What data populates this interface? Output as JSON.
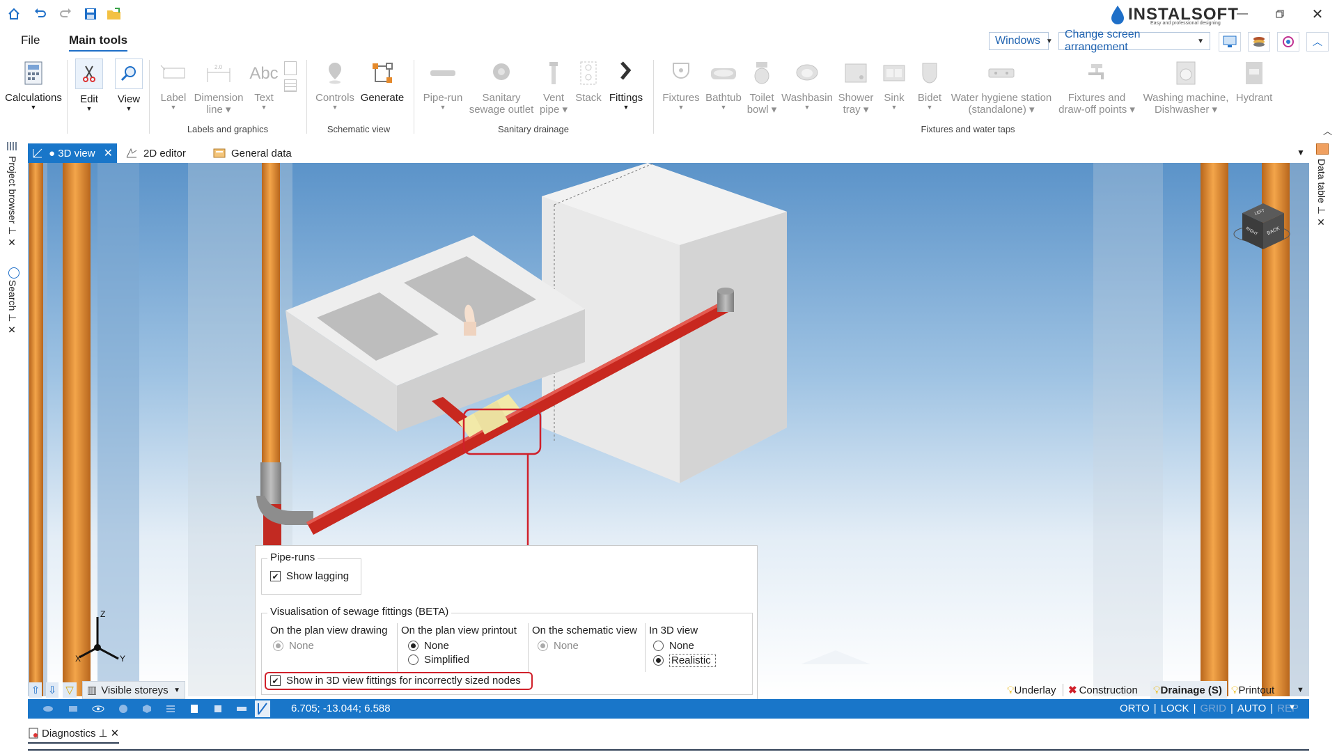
{
  "app": {
    "brand": "INSTALSOFT",
    "tagline": "Easy and professional designing"
  },
  "menu": {
    "file": "File",
    "main_tools": "Main tools",
    "windows": "Windows",
    "arrangement": "Change screen arrangement"
  },
  "ribbon": {
    "calculations": "Calculations",
    "edit": "Edit",
    "view": "View",
    "label": "Label",
    "dimension": [
      "Dimension",
      "line"
    ],
    "text": "Text",
    "controls": "Controls",
    "generate": "Generate",
    "pipe_run": "Pipe-run",
    "sanitary_outlet": [
      "Sanitary",
      "sewage outlet"
    ],
    "vent_pipe": [
      "Vent",
      "pipe"
    ],
    "stack": "Stack",
    "fittings": "Fittings",
    "fixtures": "Fixtures",
    "bathtub": "Bathtub",
    "toilet": [
      "Toilet",
      "bowl"
    ],
    "washbasin": "Washbasin",
    "shower": [
      "Shower",
      "tray"
    ],
    "sink": "Sink",
    "bidet": "Bidet",
    "water_hygiene": [
      "Water hygiene station",
      "(standalone)"
    ],
    "fixtures_drawoff": [
      "Fixtures and",
      "draw-off points"
    ],
    "washing_machine": [
      "Washing machine,",
      "Dishwasher"
    ],
    "hydrant": "Hydrant",
    "groups": {
      "labels": "Labels and graphics",
      "schematic": "Schematic view",
      "sanitary": "Sanitary drainage",
      "fixtures": "Fixtures and water taps"
    }
  },
  "side": {
    "project_browser": "Project browser",
    "search": "Search",
    "data_table": "Data table"
  },
  "tabs": {
    "view3d": "● 3D view",
    "editor2d": "2D editor",
    "general": "General data"
  },
  "navcube": {
    "top": "LEFT",
    "right": "BACK",
    "left": "RIGHT"
  },
  "axes": {
    "z": "Z",
    "x": "X",
    "y": "Y"
  },
  "popup": {
    "pipe_runs": "Pipe-runs",
    "show_lagging": "Show lagging",
    "visualisation": "Visualisation of sewage fittings (BETA)",
    "col_plan_drawing": "On the plan view drawing",
    "col_plan_printout": "On the plan view printout",
    "col_schematic": "On the schematic view",
    "col_3d": "In 3D view",
    "none": "None",
    "simplified": "Simplified",
    "realistic": "Realistic",
    "show_incorrect": "Show in 3D view fittings for incorrectly sized nodes"
  },
  "bottom": {
    "visible_storeys": "Visible storeys",
    "underlay": "Underlay",
    "construction": "Construction",
    "drainage": "Drainage (S)",
    "printout": "Printout"
  },
  "status": {
    "coords": "6.705; -13.044; 6.588",
    "orto": "ORTO",
    "lock": "LOCK",
    "grid": "GRID",
    "auto": "AUTO",
    "rep": "REP"
  },
  "diagnostics": "Diagnostics",
  "colors": {
    "accent": "#1976c9",
    "pipe_red": "#c8281f",
    "pipe_orange": "#e08a2e",
    "highlight": "#d0202a"
  }
}
